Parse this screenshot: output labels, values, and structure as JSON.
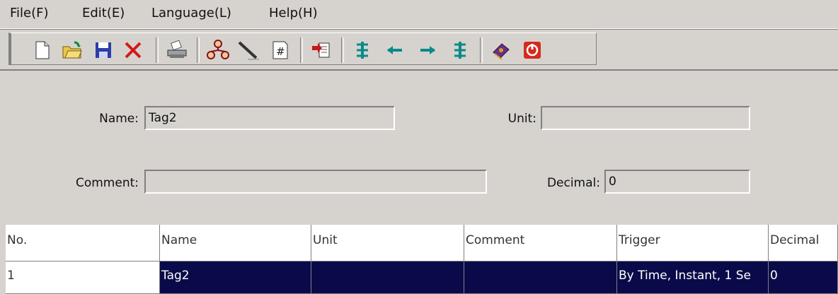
{
  "menu": {
    "items": [
      "File(F)",
      "Edit(E)",
      "Language(L)",
      "Help(H)"
    ]
  },
  "toolbar": {
    "buttons": [
      {
        "name": "new-file",
        "icon": "new-document-icon"
      },
      {
        "name": "open",
        "icon": "open-folder-icon"
      },
      {
        "name": "save",
        "icon": "save-disk-icon"
      },
      {
        "name": "delete",
        "icon": "red-x-icon"
      },
      {
        "name": "print",
        "icon": "printer-icon"
      },
      {
        "name": "network",
        "icon": "network-icon"
      },
      {
        "name": "line",
        "icon": "line-tool-icon"
      },
      {
        "name": "number",
        "icon": "number-grid-icon"
      },
      {
        "name": "import",
        "icon": "import-icon"
      },
      {
        "name": "move-top",
        "icon": "move-top-icon"
      },
      {
        "name": "move-left",
        "icon": "arrow-left-icon"
      },
      {
        "name": "move-right",
        "icon": "arrow-right-icon"
      },
      {
        "name": "move-bottom",
        "icon": "move-bottom-icon"
      },
      {
        "name": "help-book",
        "icon": "help-book-icon"
      },
      {
        "name": "exit",
        "icon": "power-exit-icon"
      }
    ]
  },
  "form": {
    "name_label": "Name:",
    "name_value": "Tag2",
    "unit_label": "Unit:",
    "unit_value": "",
    "comment_label": "Comment:",
    "comment_value": "",
    "decimal_label": "Decimal:",
    "decimal_value": "0"
  },
  "grid": {
    "columns": [
      "No.",
      "Name",
      "Unit",
      "Comment",
      "Trigger",
      "Decimal"
    ],
    "rows": [
      {
        "no": "1",
        "name": "Tag2",
        "unit": "",
        "comment": "",
        "trigger": "By Time, Instant, 1 Se",
        "decimal": "0"
      }
    ]
  },
  "colors": {
    "background": "#d6d3ce",
    "selection": "#0a0a4a",
    "accent_teal": "#0a8a8a"
  }
}
